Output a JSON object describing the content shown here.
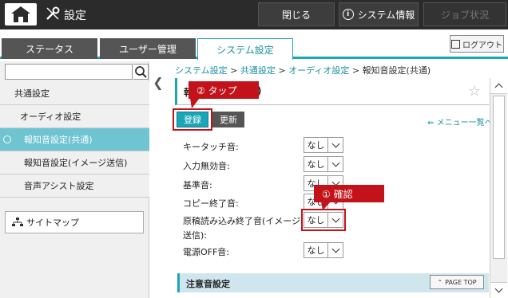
{
  "header": {
    "title": "設定",
    "close_label": "閉じる",
    "sysinfo_label": "システム情報",
    "job_label": "ジョブ状況"
  },
  "tabs": [
    {
      "label": "ステータス"
    },
    {
      "label": "ユーザー管理"
    },
    {
      "label": "システム設定"
    }
  ],
  "logout_label": "ログアウト",
  "sidebar": {
    "search_placeholder": "",
    "items": [
      {
        "label": "共通設定"
      },
      {
        "label": "オーディオ設定"
      },
      {
        "label": "報知音設定(共通)"
      },
      {
        "label": "報知音設定(イメージ送信)"
      },
      {
        "label": "音声アシスト設定"
      }
    ],
    "sitemap_label": "サイトマップ"
  },
  "breadcrumb": {
    "items": [
      "システム設定",
      "共通設定",
      "オーディオ設定"
    ],
    "separator": ">",
    "current": "報知音設定(共通)"
  },
  "panel": {
    "title_visible_start": "報",
    "title_visible_end": ")",
    "register_label": "登録",
    "update_label": "更新",
    "menu_link_label": "メニュー一覧へ"
  },
  "settings": [
    {
      "label": "キータッチ音:",
      "value": "なし"
    },
    {
      "label": "入力無効音:",
      "value": "なし"
    },
    {
      "label": "基準音:",
      "value": "なし"
    },
    {
      "label": "コピー終了音:",
      "value": "なし"
    },
    {
      "label": "原稿読み込み終了音(イメージ",
      "label2": "送信):",
      "value": "なし"
    },
    {
      "label": "電源OFF音:",
      "value": "なし"
    }
  ],
  "section2_title": "注意音設定",
  "pagetop_label": "PAGE TOP",
  "callouts": {
    "tap": "② タップ",
    "confirm": "① 確認"
  },
  "colors": {
    "accent": "#1aa6b7",
    "callout": "#c4121b",
    "topbar": "#2b2b2b"
  }
}
